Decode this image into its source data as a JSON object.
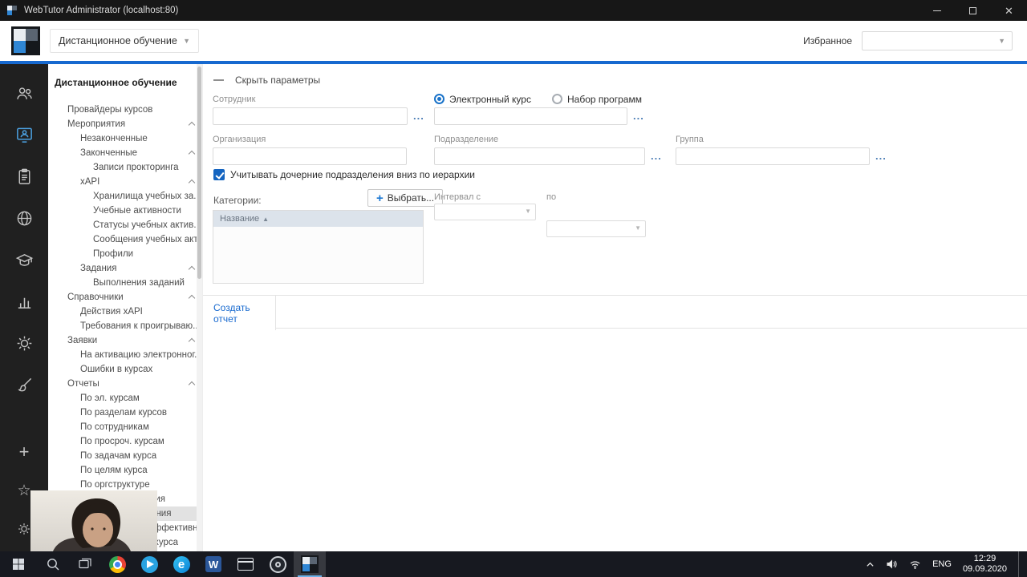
{
  "titlebar": {
    "title": "WebTutor Administrator (localhost:80)",
    "control_icons": [
      "minimize-icon",
      "maximize-icon",
      "close-icon"
    ]
  },
  "header": {
    "module_selector": {
      "value": "Дистанционное обучение"
    },
    "favorites_label": "Избранное",
    "favorites_selector": {
      "value": ""
    }
  },
  "rail": {
    "active": "monitor-person-icon",
    "icons": [
      "people-icon",
      "monitor-person-icon",
      "clipboard-icon",
      "globe-icon",
      "graduation-cap-icon",
      "bar-chart-icon",
      "gear-icon",
      "brush-icon",
      "plus-icon",
      "star-icon",
      "settings-gear-icon"
    ]
  },
  "sidebar": {
    "title": "Дистанционное обучение",
    "items": [
      {
        "label": "Провайдеры курсов",
        "indent": 1
      },
      {
        "label": "Мероприятия",
        "indent": 1,
        "chevron": true
      },
      {
        "label": "Незаконченные",
        "indent": 2
      },
      {
        "label": "Законченные",
        "indent": 2,
        "chevron": true
      },
      {
        "label": "Записи прокторинга",
        "indent": 3
      },
      {
        "label": "xAPI",
        "indent": 2,
        "chevron": true
      },
      {
        "label": "Хранилища учебных за...",
        "indent": 3
      },
      {
        "label": "Учебные активности",
        "indent": 3
      },
      {
        "label": "Статусы учебных актив...",
        "indent": 3
      },
      {
        "label": "Сообщения учебных акт...",
        "indent": 3
      },
      {
        "label": "Профили",
        "indent": 3
      },
      {
        "label": "Задания",
        "indent": 2,
        "chevron": true
      },
      {
        "label": "Выполнения заданий",
        "indent": 3
      },
      {
        "label": "Справочники",
        "indent": 1,
        "chevron": true
      },
      {
        "label": "Действия xAPI",
        "indent": 2
      },
      {
        "label": "Требования к проигрываю...",
        "indent": 2
      },
      {
        "label": "Заявки",
        "indent": 1,
        "chevron": true
      },
      {
        "label": "На активацию электронног...",
        "indent": 2
      },
      {
        "label": "Ошибки в курсах",
        "indent": 2
      },
      {
        "label": "Отчеты",
        "indent": 1,
        "chevron": true
      },
      {
        "label": "По эл. курсам",
        "indent": 2
      },
      {
        "label": "По разделам курсов",
        "indent": 2
      },
      {
        "label": "По сотрудникам",
        "indent": 2
      },
      {
        "label": "По просроч. курсам",
        "indent": 2
      },
      {
        "label": "По задачам курса",
        "indent": 2
      },
      {
        "label": "По целям курса",
        "indent": 2
      },
      {
        "label": "По оргструктуре",
        "indent": 2
      },
      {
        "label": "Динамика обучения",
        "indent": 2
      },
      {
        "label": "Статистика обучения",
        "indent": 2,
        "selected": true
      },
      {
        "label": "Сравнительная эффективнос...",
        "indent": 2
      },
      {
        "label": "Вопросы модуля курса",
        "indent": 2
      }
    ]
  },
  "main": {
    "toolbar": {
      "hide_params": "Скрыть параметры"
    },
    "form": {
      "employee": {
        "label": "Сотрудник",
        "value": ""
      },
      "course_type": {
        "options": [
          {
            "label": "Электронный курс",
            "selected": true
          },
          {
            "label": "Набор программ",
            "selected": false
          }
        ],
        "value": ""
      },
      "organization": {
        "label": "Организация",
        "value": ""
      },
      "department": {
        "label": "Подразделение",
        "value": ""
      },
      "group": {
        "label": "Группа",
        "value": ""
      },
      "include_children": {
        "label": "Учитывать дочерние подразделения вниз по иерархии",
        "checked": true
      },
      "categories": {
        "label": "Категории:",
        "button_label": "Выбрать...",
        "list_header": "Название"
      },
      "interval": {
        "from_label": "Интервал с",
        "to_label": "по",
        "from_value": "",
        "to_value": ""
      }
    },
    "tabs": [
      {
        "label": "Создать отчет",
        "active": true
      }
    ]
  },
  "taskbar": {
    "icons": [
      "start-icon",
      "search-icon",
      "task-view-icon",
      "chrome-icon",
      "telegram-icon",
      "edge-icon",
      "word-icon",
      "console-icon",
      "recorder-icon",
      "webtutor-icon"
    ],
    "active_app": "webtutor-icon",
    "tray": {
      "icons": [
        "chevron-up-icon",
        "volume-icon",
        "network-icon"
      ],
      "lang": "ENG",
      "time": "12:29",
      "date": "09.09.2020"
    }
  }
}
